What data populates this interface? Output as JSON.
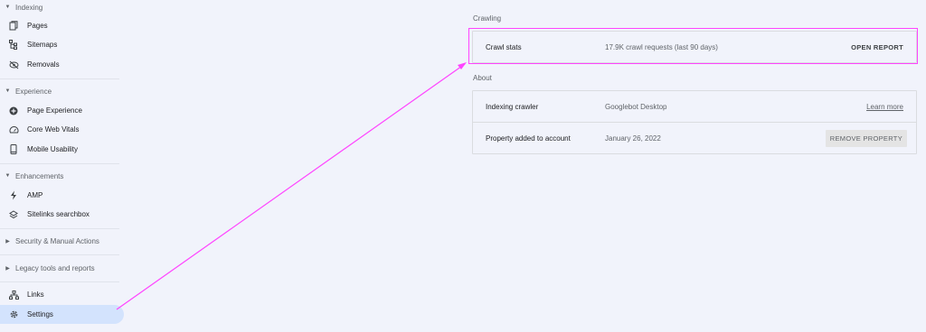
{
  "sidebar": {
    "sections": [
      {
        "title": "Indexing",
        "items": [
          {
            "label": "Pages",
            "icon": "pages-icon"
          },
          {
            "label": "Sitemaps",
            "icon": "sitemap-icon"
          },
          {
            "label": "Removals",
            "icon": "removals-icon"
          }
        ]
      },
      {
        "title": "Experience",
        "items": [
          {
            "label": "Page Experience",
            "icon": "page-experience-icon"
          },
          {
            "label": "Core Web Vitals",
            "icon": "speedometer-icon"
          },
          {
            "label": "Mobile Usability",
            "icon": "phone-icon"
          }
        ]
      },
      {
        "title": "Enhancements",
        "items": [
          {
            "label": "AMP",
            "icon": "bolt-icon"
          },
          {
            "label": "Sitelinks searchbox",
            "icon": "layers-icon"
          }
        ]
      },
      {
        "title": "Security & Manual Actions",
        "items": []
      },
      {
        "title": "Legacy tools and reports",
        "items": []
      }
    ],
    "bottom_items": [
      {
        "label": "Links",
        "icon": "links-icon"
      },
      {
        "label": "Settings",
        "icon": "gear-icon",
        "active": true
      }
    ]
  },
  "main": {
    "crawling": {
      "label": "Crawling",
      "rows": [
        {
          "name": "Crawl stats",
          "value": "17.9K crawl requests (last 90 days)",
          "action": "OPEN REPORT"
        }
      ]
    },
    "about": {
      "label": "About",
      "rows": [
        {
          "name": "Indexing crawler",
          "value": "Googlebot Desktop",
          "action": "Learn more"
        },
        {
          "name": "Property added to account",
          "value": "January 26, 2022",
          "action": "REMOVE PROPERTY"
        }
      ]
    }
  },
  "annotation": {
    "color": "#ff44ff"
  }
}
